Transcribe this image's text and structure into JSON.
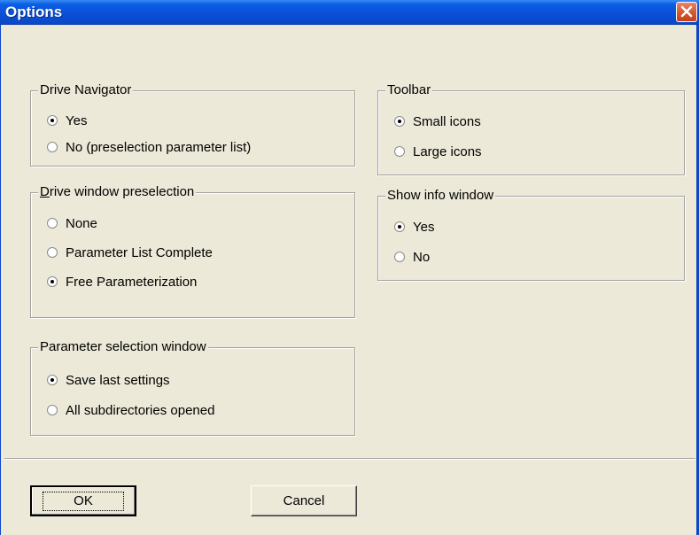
{
  "window": {
    "title": "Options"
  },
  "groups": {
    "drive_navigator": {
      "label": "Drive Navigator",
      "options": [
        "Yes",
        "No (preselection parameter list)"
      ],
      "selected": "Yes"
    },
    "drive_window": {
      "label": "Drive window preselection",
      "options": [
        "None",
        "Parameter List Complete",
        "Free Parameterization"
      ],
      "selected": "Free Parameterization"
    },
    "param_selection": {
      "label": "Parameter selection window",
      "options": [
        "Save last settings",
        "All subdirectories opened"
      ],
      "selected": "Save last settings"
    },
    "toolbar": {
      "label": "Toolbar",
      "options": [
        "Small icons",
        "Large icons"
      ],
      "selected": "Small icons"
    },
    "info_window": {
      "label": "Show info window",
      "options": [
        "Yes",
        "No"
      ],
      "selected": "Yes"
    }
  },
  "buttons": {
    "ok": "OK",
    "cancel": "Cancel"
  }
}
